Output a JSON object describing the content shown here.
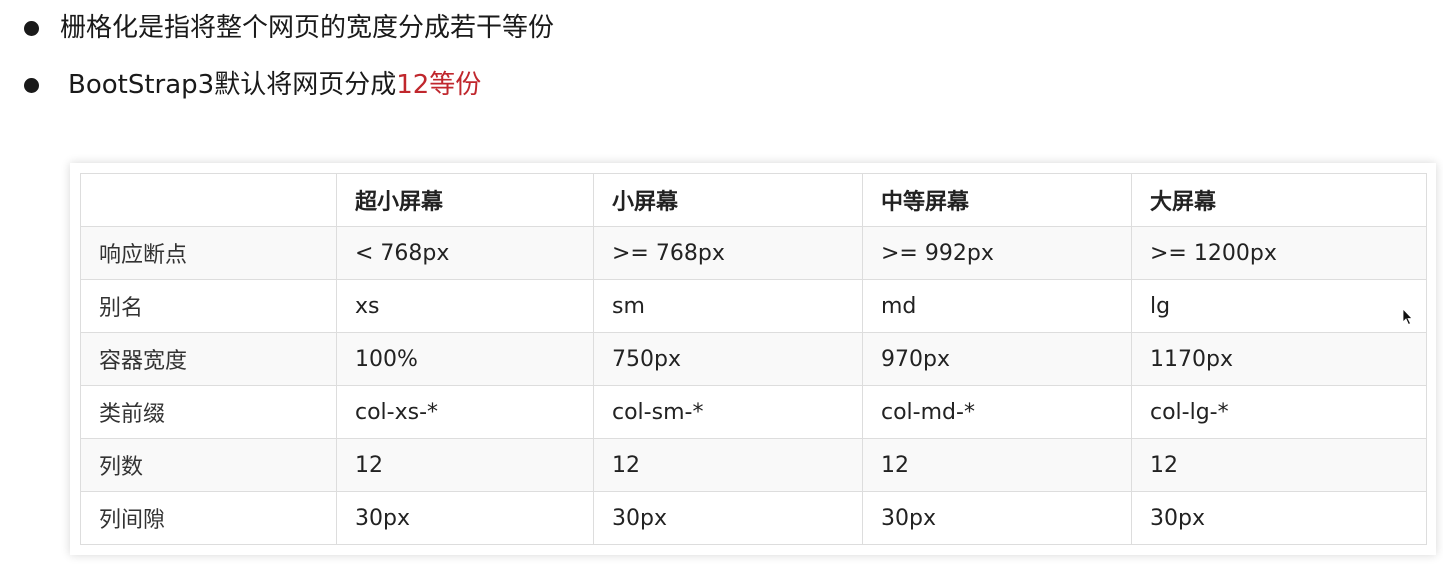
{
  "bullets": [
    {
      "text": "栅格化是指将整个网页的宽度分成若干等份"
    },
    {
      "prefix": "BootStrap3默认将网页分成",
      "highlight": "12等份"
    }
  ],
  "accent_color": "#c0272d",
  "table": {
    "headers": [
      "",
      "超小屏幕",
      "小屏幕",
      "中等屏幕",
      "大屏幕"
    ],
    "rows": [
      [
        "响应断点",
        "< 768px",
        ">= 768px",
        ">= 992px",
        ">= 1200px"
      ],
      [
        "别名",
        "xs",
        "sm",
        "md",
        "lg"
      ],
      [
        "容器宽度",
        "100%",
        "750px",
        "970px",
        "1170px"
      ],
      [
        "类前缀",
        "col-xs-*",
        "col-sm-*",
        "col-md-*",
        "col-lg-*"
      ],
      [
        "列数",
        "12",
        "12",
        "12",
        "12"
      ],
      [
        "列间隙",
        "30px",
        "30px",
        "30px",
        "30px"
      ]
    ]
  },
  "icons": {
    "cursor": "mouse-pointer-icon"
  }
}
